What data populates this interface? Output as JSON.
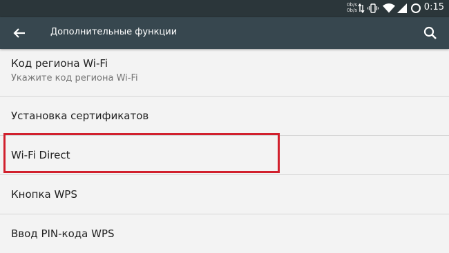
{
  "status_bar": {
    "speed_up": "0b/s",
    "speed_down": "0b/s",
    "icons": [
      "data-arrows-icon",
      "vibrate-icon",
      "wifi-icon",
      "signal-icon",
      "battery-icon"
    ],
    "time": "0:15"
  },
  "toolbar": {
    "back_icon": "arrow-back-icon",
    "title": "Дополнительные функции",
    "search_icon": "search-icon"
  },
  "settings": [
    {
      "title": "Код региона Wi-Fi",
      "summary": "Укажите код региона Wi-Fi"
    },
    {
      "title": "Установка сертификатов"
    },
    {
      "title": "Wi-Fi Direct",
      "highlighted": true
    },
    {
      "title": "Кнопка WPS"
    },
    {
      "title": "Ввод PIN-кода WPS"
    }
  ],
  "colors": {
    "status_bar": "#2b363a",
    "toolbar": "#37474f",
    "background": "#f3f3f3",
    "highlight_border": "#d1202d"
  }
}
